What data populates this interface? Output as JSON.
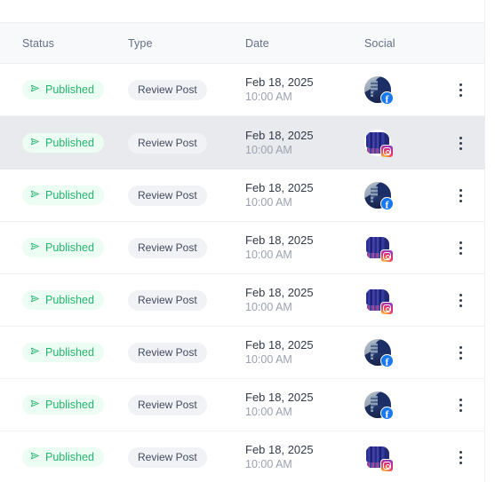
{
  "table": {
    "columns": [
      {
        "key": "status",
        "label": "Status"
      },
      {
        "key": "type",
        "label": "Type"
      },
      {
        "key": "date",
        "label": "Date"
      },
      {
        "key": "social",
        "label": "Social"
      },
      {
        "key": "actions",
        "label": ""
      }
    ],
    "rows": [
      {
        "status": "Published",
        "status_icon": "send-icon",
        "type": "Review Post",
        "date": "Feb 18, 2025",
        "time": "10:00 AM",
        "social": "facebook",
        "social_icon": "facebook-icon",
        "avatar": "avatar-office-photo",
        "menu_icon": "kebab-menu-icon",
        "highlighted": false
      },
      {
        "status": "Published",
        "status_icon": "send-icon",
        "type": "Review Post",
        "date": "Feb 18, 2025",
        "time": "10:00 AM",
        "social": "instagram",
        "social_icon": "instagram-icon",
        "avatar": "avatar-building-photo",
        "menu_icon": "kebab-menu-icon",
        "highlighted": true
      },
      {
        "status": "Published",
        "status_icon": "send-icon",
        "type": "Review Post",
        "date": "Feb 18, 2025",
        "time": "10:00 AM",
        "social": "facebook",
        "social_icon": "facebook-icon",
        "avatar": "avatar-office-photo",
        "menu_icon": "kebab-menu-icon",
        "highlighted": false
      },
      {
        "status": "Published",
        "status_icon": "send-icon",
        "type": "Review Post",
        "date": "Feb 18, 2025",
        "time": "10:00 AM",
        "social": "instagram",
        "social_icon": "instagram-icon",
        "avatar": "avatar-building-photo",
        "menu_icon": "kebab-menu-icon",
        "highlighted": false
      },
      {
        "status": "Published",
        "status_icon": "send-icon",
        "type": "Review Post",
        "date": "Feb 18, 2025",
        "time": "10:00 AM",
        "social": "instagram",
        "social_icon": "instagram-icon",
        "avatar": "avatar-building-photo",
        "menu_icon": "kebab-menu-icon",
        "highlighted": false
      },
      {
        "status": "Published",
        "status_icon": "send-icon",
        "type": "Review Post",
        "date": "Feb 18, 2025",
        "time": "10:00 AM",
        "social": "facebook",
        "social_icon": "facebook-icon",
        "avatar": "avatar-office-photo",
        "menu_icon": "kebab-menu-icon",
        "highlighted": false
      },
      {
        "status": "Published",
        "status_icon": "send-icon",
        "type": "Review Post",
        "date": "Feb 18, 2025",
        "time": "10:00 AM",
        "social": "facebook",
        "social_icon": "facebook-icon",
        "avatar": "avatar-office-photo",
        "menu_icon": "kebab-menu-icon",
        "highlighted": false
      },
      {
        "status": "Published",
        "status_icon": "send-icon",
        "type": "Review Post",
        "date": "Feb 18, 2025",
        "time": "10:00 AM",
        "social": "instagram",
        "social_icon": "instagram-icon",
        "avatar": "avatar-building-photo",
        "menu_icon": "kebab-menu-icon",
        "highlighted": false
      }
    ]
  },
  "colors": {
    "status_published_text": "#25b46e",
    "status_published_bg": "#ecfdf3",
    "type_badge_bg": "#f1f2f6",
    "type_badge_text": "#414b5e",
    "header_bg": "#f8f9fb",
    "header_text": "#626e85",
    "date_text": "#323a49",
    "time_text": "#9aa1b0",
    "row_highlight_bg": "#e9eaee",
    "row_divider": "#f1f2f6",
    "facebook_blue": "#1877f2",
    "kebab_dot": "#2f3a4d"
  }
}
